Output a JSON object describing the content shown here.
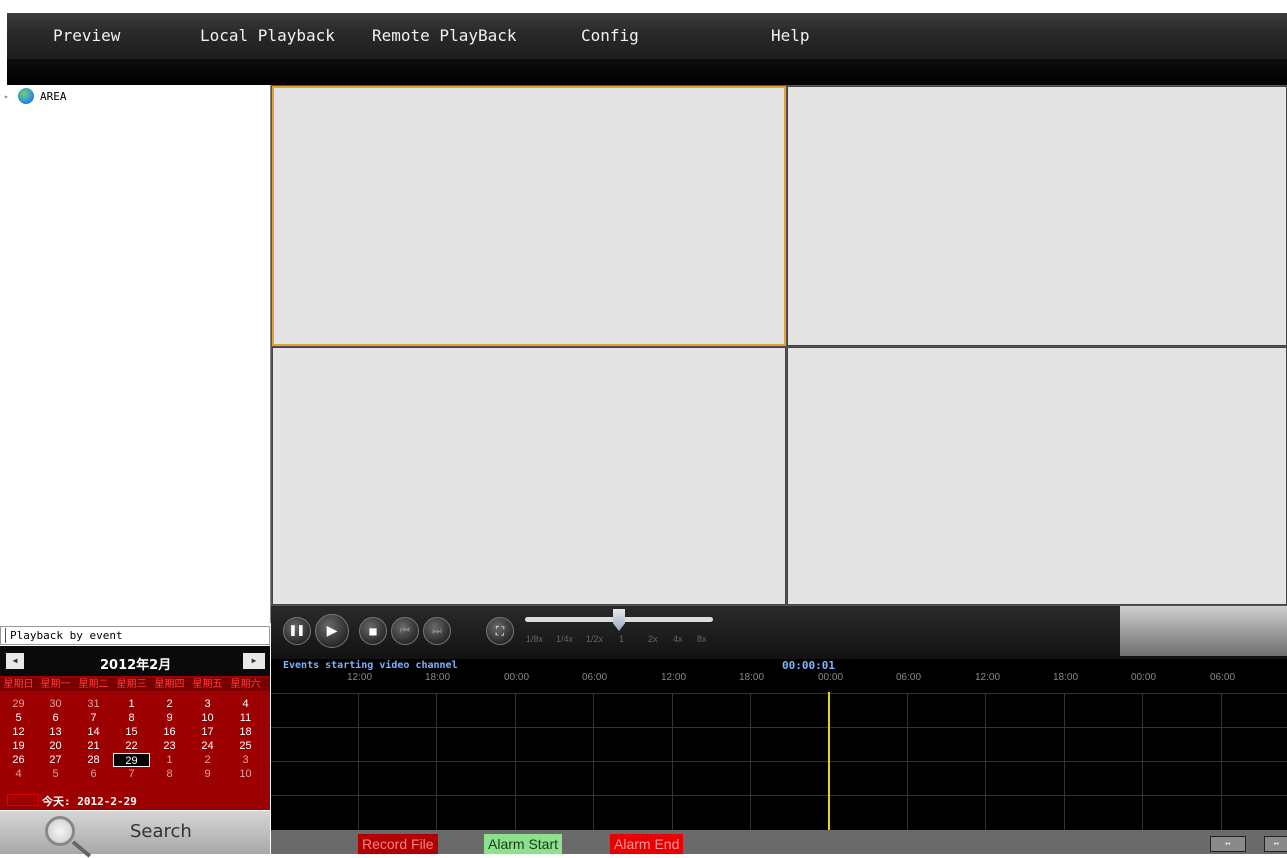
{
  "menu": {
    "items": [
      "Preview",
      "Local Playback",
      "Remote PlayBack",
      "Config",
      "Help"
    ]
  },
  "tree": {
    "root_label": "AREA",
    "root_icon": "globe-icon"
  },
  "playback_by_event": {
    "label": "Playback by event"
  },
  "calendar": {
    "title": "2012年2月",
    "prev_icon": "chevron-left-icon",
    "next_icon": "chevron-right-icon",
    "weekdays": [
      "星期日",
      "星期一",
      "星期二",
      "星期三",
      "星期四",
      "星期五",
      "星期六"
    ],
    "weeks": [
      [
        "29",
        "30",
        "31",
        "1",
        "2",
        "3",
        "4"
      ],
      [
        "5",
        "6",
        "7",
        "8",
        "9",
        "10",
        "11"
      ],
      [
        "12",
        "13",
        "14",
        "15",
        "16",
        "17",
        "18"
      ],
      [
        "19",
        "20",
        "21",
        "22",
        "23",
        "24",
        "25"
      ],
      [
        "26",
        "27",
        "28",
        "29",
        "1",
        "2",
        "3"
      ],
      [
        "4",
        "5",
        "6",
        "7",
        "8",
        "9",
        "10"
      ]
    ],
    "selected": "29",
    "today_label": "今天: 2012-2-29"
  },
  "search": {
    "label": "Search",
    "icon": "magnifier-icon"
  },
  "controls": {
    "buttons": [
      "pause-icon",
      "play-icon",
      "stop-icon",
      "step-back-icon",
      "step-forward-icon",
      "fullscreen-icon"
    ],
    "speed_labels": [
      "1/8x",
      "1/4x",
      "1/2x",
      "1",
      "2x",
      "4x",
      "8x"
    ],
    "speed_selected": "1"
  },
  "timeline": {
    "events_label": "Events starting video channel",
    "current_time": "00:00:01",
    "ticks": [
      "12:00",
      "18:00",
      "00:00",
      "06:00",
      "12:00",
      "18:00",
      "00:00",
      "06:00",
      "12:00",
      "18:00",
      "00:00",
      "06:00"
    ]
  },
  "legend": {
    "record_file": "Record File",
    "alarm_start": "Alarm Start",
    "alarm_end": "Alarm End",
    "zoom_in": "↔",
    "zoom_out": "↔"
  },
  "colors": {
    "record_file": "#b00000",
    "alarm_start": "#8de08d",
    "alarm_end": "#e80000",
    "active_pane_border": "#e5a232",
    "cursor_line": "#e8d318",
    "calendar_bg": "#9c0000"
  }
}
